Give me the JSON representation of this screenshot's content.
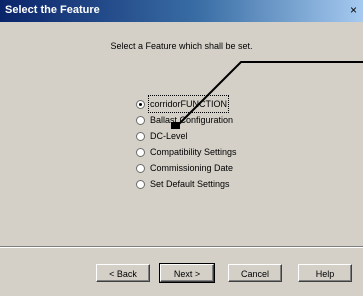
{
  "window": {
    "title": "Select the Feature",
    "close_glyph": "×"
  },
  "instruction": "Select a Feature which shall be set.",
  "options": [
    {
      "label": "corridorFUNCTION",
      "selected": true
    },
    {
      "label": "Ballast Configuration",
      "selected": false
    },
    {
      "label": "DC-Level",
      "selected": false
    },
    {
      "label": "Compatibility Settings",
      "selected": false
    },
    {
      "label": "Commissioning  Date",
      "selected": false
    },
    {
      "label": "Set Default Settings",
      "selected": false
    }
  ],
  "buttons": {
    "back": "< Back",
    "next": "Next >",
    "cancel": "Cancel",
    "help": "Help"
  },
  "colors": {
    "titlebar_start": "#0a246a",
    "titlebar_end": "#a6caf0",
    "dialog_bg": "#d4d0c8"
  }
}
